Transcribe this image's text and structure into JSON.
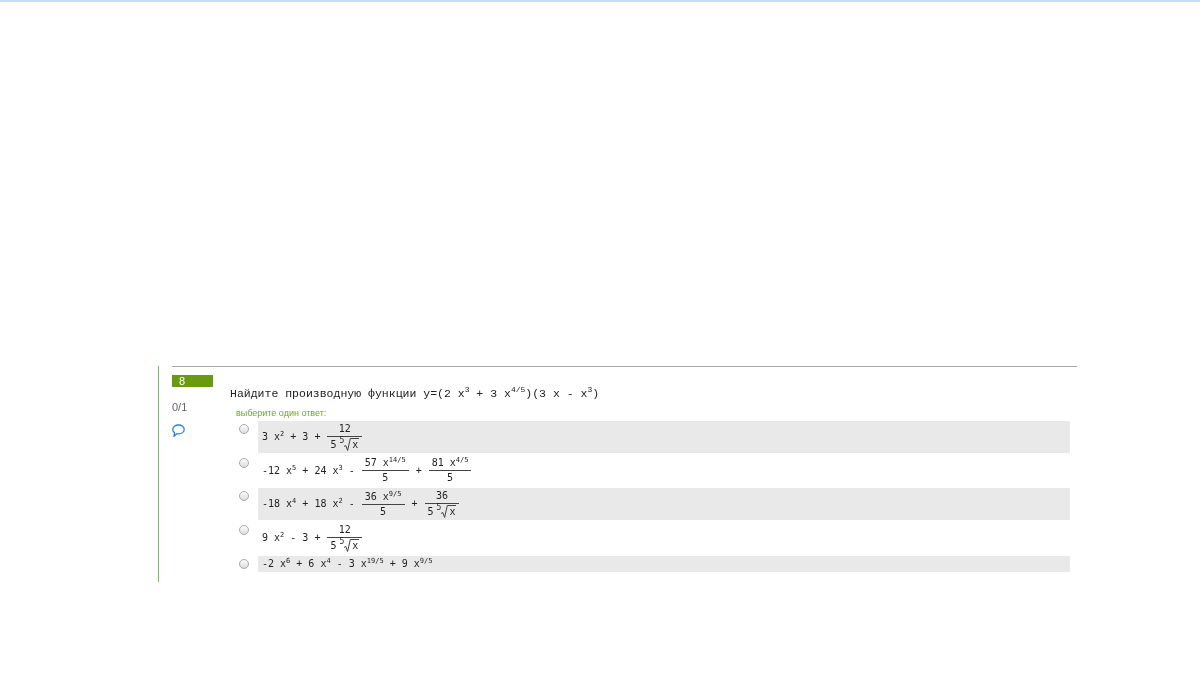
{
  "question": {
    "number": "8",
    "score": "0/1",
    "text": "Найдите производную функции y=(2 x$^{3}$ + 3 x$^{4/5}$)(3 x - x$^{3}$)",
    "instruction": "выберите один ответ:",
    "options": [
      {
        "selected": false,
        "expression": [
          {
            "kind": "text",
            "text": "3 x$^{2}$ + 3 +"
          },
          {
            "kind": "fraction",
            "numerator": [
              {
                "kind": "text",
                "text": "12"
              }
            ],
            "denominator": [
              {
                "kind": "text",
                "text": "5"
              },
              {
                "kind": "root",
                "index": "5",
                "radicand": "x"
              }
            ]
          }
        ]
      },
      {
        "selected": false,
        "expression": [
          {
            "kind": "text",
            "text": "-12 x$^{5}$ + 24 x$^{3}$ -"
          },
          {
            "kind": "fraction",
            "numerator": [
              {
                "kind": "text",
                "text": "57 x$^{14/5}$"
              }
            ],
            "denominator": [
              {
                "kind": "text",
                "text": "5"
              }
            ]
          },
          {
            "kind": "text",
            "text": "+"
          },
          {
            "kind": "fraction",
            "numerator": [
              {
                "kind": "text",
                "text": "81 x$^{4/5}$"
              }
            ],
            "denominator": [
              {
                "kind": "text",
                "text": "5"
              }
            ]
          }
        ]
      },
      {
        "selected": false,
        "expression": [
          {
            "kind": "text",
            "text": "-18 x$^{4}$ + 18 x$^{2}$ -"
          },
          {
            "kind": "fraction",
            "numerator": [
              {
                "kind": "text",
                "text": "36 x$^{9/5}$"
              }
            ],
            "denominator": [
              {
                "kind": "text",
                "text": "5"
              }
            ]
          },
          {
            "kind": "text",
            "text": "+"
          },
          {
            "kind": "fraction",
            "numerator": [
              {
                "kind": "text",
                "text": "36"
              }
            ],
            "denominator": [
              {
                "kind": "text",
                "text": "5"
              },
              {
                "kind": "root",
                "index": "5",
                "radicand": "x"
              }
            ]
          }
        ]
      },
      {
        "selected": false,
        "expression": [
          {
            "kind": "text",
            "text": "9 x$^{2}$ - 3 +"
          },
          {
            "kind": "fraction",
            "numerator": [
              {
                "kind": "text",
                "text": "12"
              }
            ],
            "denominator": [
              {
                "kind": "text",
                "text": "5"
              },
              {
                "kind": "root",
                "index": "5",
                "radicand": "x"
              }
            ]
          }
        ]
      },
      {
        "selected": false,
        "expression": [
          {
            "kind": "text",
            "text": "-2 x$^{6}$ + 6 x$^{4}$ - 3 x$^{19/5}$ + 9 x$^{9/5}$"
          }
        ]
      }
    ]
  }
}
